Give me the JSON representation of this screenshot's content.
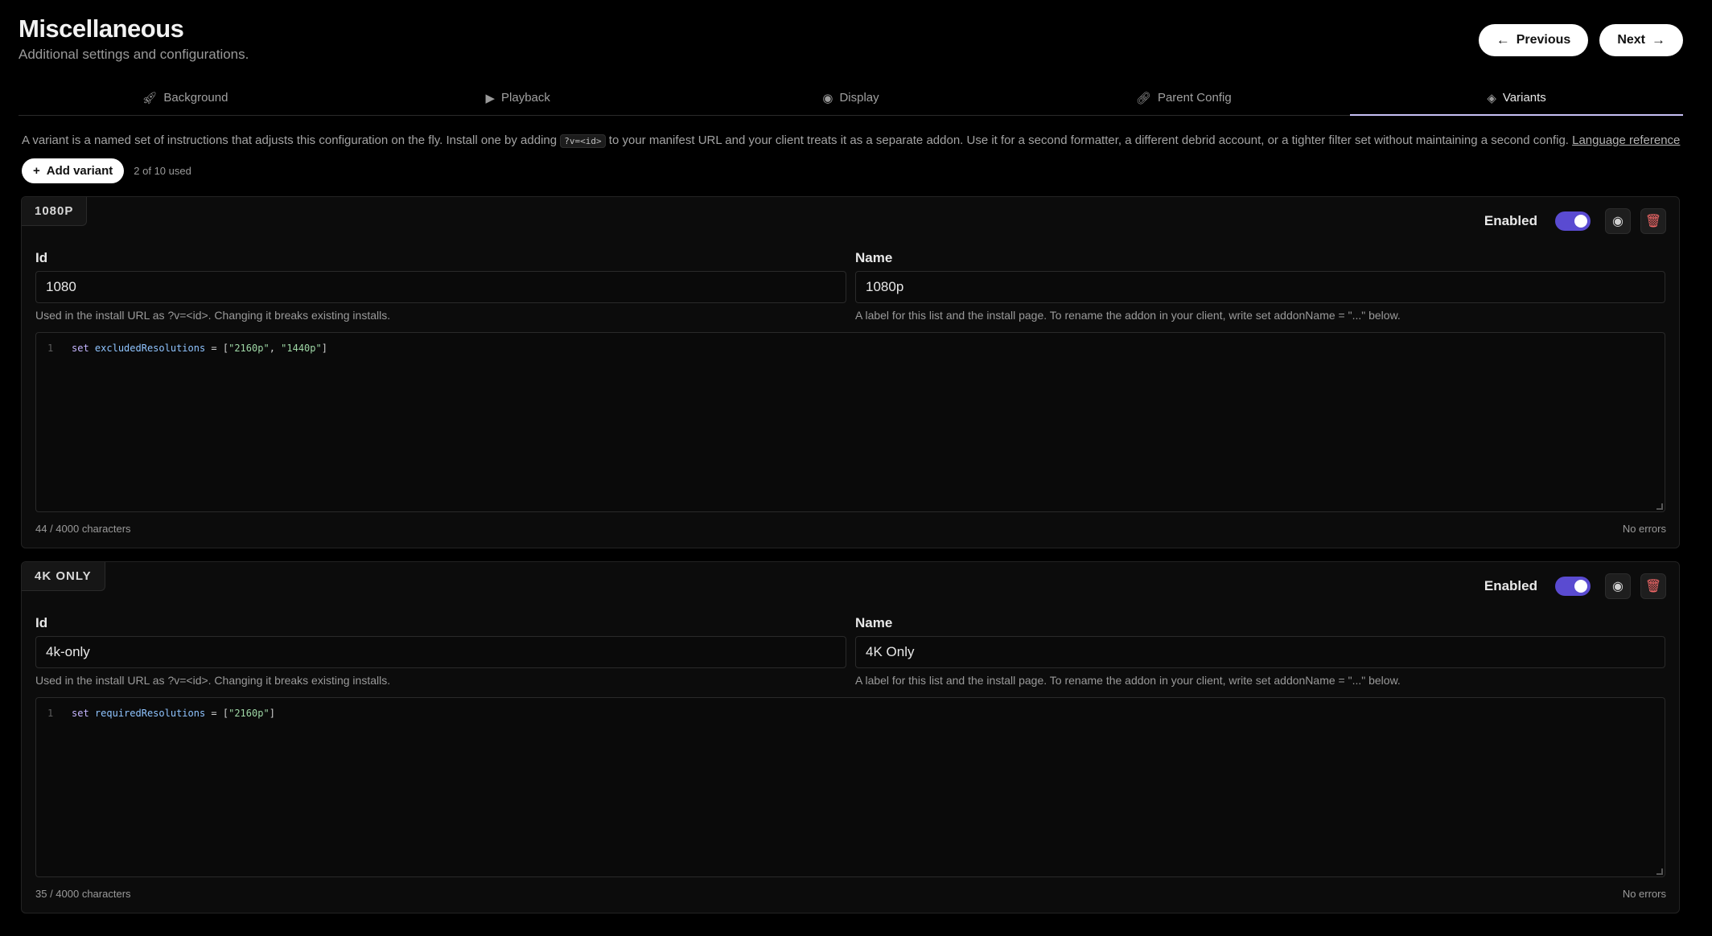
{
  "header": {
    "title": "Miscellaneous",
    "subtitle": "Additional settings and configurations."
  },
  "nav": {
    "previous_label": "Previous",
    "next_label": "Next"
  },
  "tabs": [
    {
      "label": "Background",
      "icon": "rocket-icon",
      "active": false
    },
    {
      "label": "Playback",
      "icon": "play-icon",
      "active": false
    },
    {
      "label": "Display",
      "icon": "eye-icon",
      "active": false
    },
    {
      "label": "Parent Config",
      "icon": "link-icon",
      "active": false
    },
    {
      "label": "Variants",
      "icon": "layers-icon",
      "active": true
    }
  ],
  "intro": {
    "text_before": "A variant is a named set of instructions that adjusts this configuration on the fly. Install one by adding ",
    "code": "?v=<id>",
    "text_after": " to your manifest URL and your client treats it as a separate addon. Use it for a second formatter, a different debrid account, or a tighter filter set without maintaining a second config. ",
    "link": "Language reference"
  },
  "add_variant": {
    "label": "Add variant",
    "used": "2 of 10 used"
  },
  "variants": [
    {
      "badge": "1080P",
      "enabled_label": "Enabled",
      "id_label": "Id",
      "id_value": "1080",
      "id_hint": "Used in the install URL as ?v=<id>. Changing it breaks existing installs.",
      "name_label": "Name",
      "name_value": "1080p",
      "name_hint": "A label for this list and the install page. To rename the addon in your client, write set addonName = \"...\" below.",
      "line_number": "1",
      "code_kw": "set",
      "code_id": "excludedResolutions",
      "code_op": " = [",
      "code_str1": "\"2160p\"",
      "code_sep": ", ",
      "code_str2": "\"1440p\"",
      "code_end": "]",
      "char_count": "44 / 4000 characters",
      "errors": "No errors"
    },
    {
      "badge": "4K ONLY",
      "enabled_label": "Enabled",
      "id_label": "Id",
      "id_value": "4k-only",
      "id_hint": "Used in the install URL as ?v=<id>. Changing it breaks existing installs.",
      "name_label": "Name",
      "name_value": "4K Only",
      "name_hint": "A label for this list and the install page. To rename the addon in your client, write set addonName = \"...\" below.",
      "line_number": "1",
      "code_kw": "set",
      "code_id": "requiredResolutions",
      "code_op": " = [",
      "code_str1": "\"2160p\"",
      "code_end": "]",
      "char_count": "35 / 4000 characters",
      "errors": "No errors"
    }
  ],
  "colors": {
    "accent": "#5a4bd1",
    "tab_underline": "#c7c0f5",
    "danger": "#f06767"
  }
}
